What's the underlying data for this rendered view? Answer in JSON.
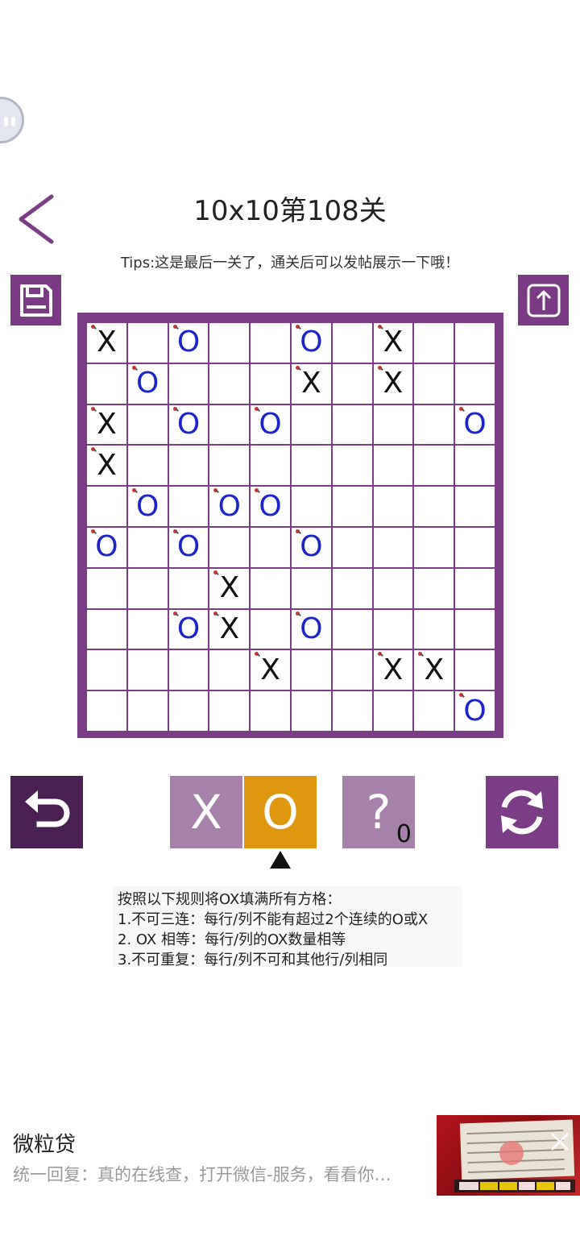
{
  "header": {
    "title": "10x10第108关",
    "tips": "Tips:这是最后一关了，通关后可以发帖展示一下哦！"
  },
  "board": {
    "rows": [
      [
        "X",
        "",
        "O",
        "",
        "",
        "O",
        "",
        "X",
        "",
        ""
      ],
      [
        "",
        "O",
        "",
        "",
        "",
        "X",
        "",
        "X",
        "",
        ""
      ],
      [
        "X",
        "",
        "O",
        "",
        "O",
        "",
        "",
        "",
        "",
        "O"
      ],
      [
        "X",
        "",
        "",
        "",
        "",
        "",
        "",
        "",
        "",
        ""
      ],
      [
        "",
        "O",
        "",
        "O",
        "O",
        "",
        "",
        "",
        "",
        ""
      ],
      [
        "O",
        "",
        "O",
        "",
        "",
        "O",
        "",
        "",
        "",
        ""
      ],
      [
        "",
        "",
        "",
        "X",
        "",
        "",
        "",
        "",
        "",
        ""
      ],
      [
        "",
        "",
        "O",
        "X",
        "",
        "O",
        "",
        "",
        "",
        ""
      ],
      [
        "",
        "",
        "",
        "",
        "X",
        "",
        "",
        "X",
        "X",
        ""
      ],
      [
        "",
        "",
        "",
        "",
        "",
        "",
        "",
        "",
        "",
        "O"
      ]
    ]
  },
  "controls": {
    "x_label": "X",
    "o_label": "O",
    "hint_label": "?",
    "hint_count": "0",
    "selected": "O"
  },
  "rules": {
    "heading": "按照以下规则将OX填满所有方格：",
    "items": [
      "1.不可三连：每行/列不能有超过2个连续的O或X",
      "2. OX 相等：每行/列的OX数量相等",
      "3.不可重复：每行/列不可和其他行/列相同"
    ]
  },
  "ad": {
    "title": "微粒贷",
    "description": "统一回复：真的在线查，打开微信-服务，看看你…"
  },
  "colors": {
    "accent": "#7b3d85",
    "x_color": "#111111",
    "o_color": "#1c25c9",
    "selected_choice": "#e09710",
    "unselected_choice": "#a682ab"
  },
  "icons": {
    "back": "chevron-left-icon",
    "save": "save-icon",
    "share": "share-icon",
    "undo": "undo-icon",
    "reset": "refresh-icon",
    "close": "close-icon"
  }
}
